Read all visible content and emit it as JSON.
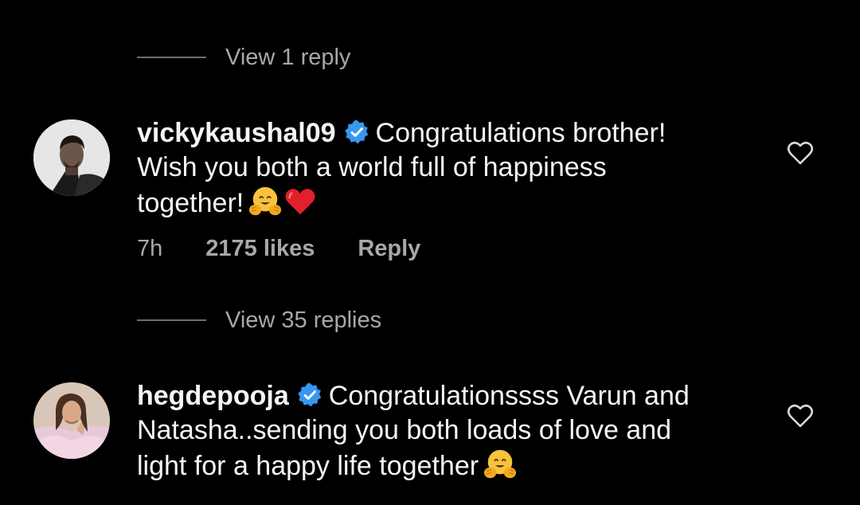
{
  "threads": {
    "view_reply_top": "View 1 reply",
    "view_replies_mid": "View 35 replies"
  },
  "comments": [
    {
      "username": "vickykaushal09",
      "text_line1": "Congratulations brother!",
      "text_line2": "Wish you both a world full of happiness",
      "text_line3": "together!",
      "time": "7h",
      "likes": "2175 likes",
      "reply": "Reply"
    },
    {
      "username": "hegdepooja",
      "text_line1": "Congratulationssss Varun and",
      "text_line2": "Natasha..sending you both loads of love and",
      "text_line3": "light for a happy life together",
      "time": "",
      "likes": "",
      "reply": ""
    }
  ],
  "icons": {
    "verified": "verified-badge-icon",
    "hug": "hugging-face-emoji",
    "heart_red": "red-heart-emoji",
    "like": "heart-outline-icon"
  },
  "colors": {
    "background": "#000000",
    "text_primary": "#f5f5f5",
    "text_secondary": "#a8a8a8",
    "verified_blue": "#3897f0",
    "heart_red": "#e0202b"
  }
}
